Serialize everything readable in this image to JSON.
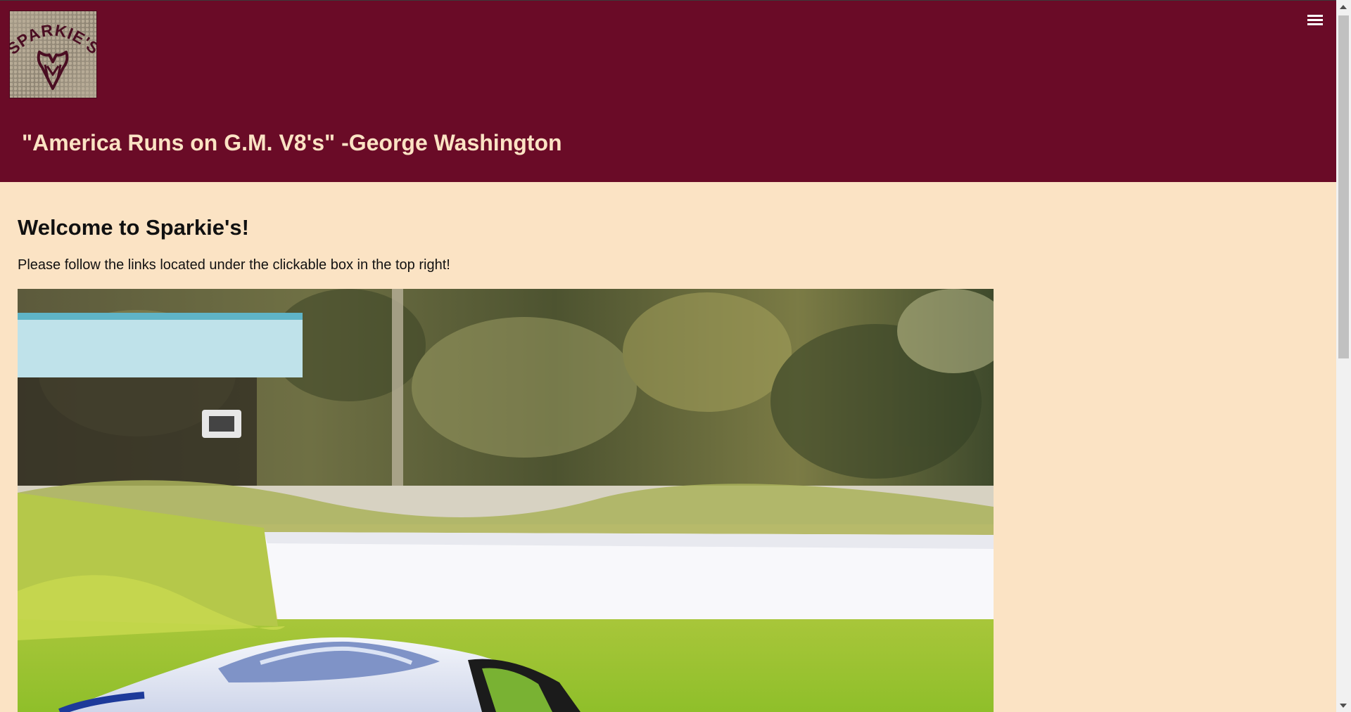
{
  "header": {
    "logo_text": "SPARKIE'S",
    "logo_icon": "ram-head-icon",
    "menu_icon": "hamburger-menu-icon",
    "tagline": "\"America Runs on G.M. V8's\" -George Washington",
    "background_color": "#6a0b27",
    "tagline_color": "#fbe3c4"
  },
  "main": {
    "heading": "Welcome to Sparkie's!",
    "intro": "Please follow the links located under the clickable box in the top right!",
    "background_color": "#fbe3c4"
  }
}
